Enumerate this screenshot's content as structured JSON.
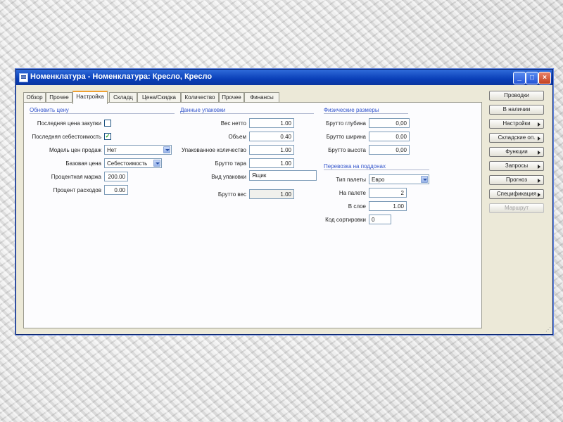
{
  "window": {
    "title": "Номенклатура - Номенклатура: Кресло, Кресло"
  },
  "tabs": [
    {
      "label": "Обзор"
    },
    {
      "label": "Прочее"
    },
    {
      "label": "Настройка"
    },
    {
      "label": "Складц"
    },
    {
      "label": "Цена/Скидка"
    },
    {
      "label": "Количество"
    },
    {
      "label": "Прочее"
    },
    {
      "label": "Финансы"
    }
  ],
  "cost_section": {
    "title": "Обновить цену",
    "last_purchase_price": {
      "label": "Последняя цена закупки",
      "checked": false
    },
    "last_cost": {
      "label": "Последняя себестоимость",
      "checked": true
    },
    "sales_model": {
      "label": "Модель цен продаж",
      "value": "Нет"
    },
    "base_price": {
      "label": "Базовая цена",
      "value": "Себестоимость"
    },
    "percent_markup": {
      "label": "Процентная маржа",
      "value": "200.00"
    },
    "percent_expense": {
      "label": "Процент расходов",
      "value": "0.00"
    }
  },
  "packing_section": {
    "title": "Данные упаковки",
    "net": {
      "label": "Вес нетто",
      "value": "1.00"
    },
    "volume": {
      "label": "Объем",
      "value": "0.40"
    },
    "packed_qty": {
      "label": "Упакованное количество",
      "value": "1.00"
    },
    "gross_tare": {
      "label": "Брутто тара",
      "value": "1.00"
    },
    "pack_group": {
      "label": "Вид упаковки",
      "value": "Ящик"
    },
    "gross": {
      "label": "Брутто вес",
      "value": "1.00"
    }
  },
  "physical_section": {
    "title": "Физические размеры",
    "depth": {
      "label": "Брутто глубина",
      "value": "0,00"
    },
    "width": {
      "label": "Брутто ширина",
      "value": "0,00"
    },
    "height": {
      "label": "Брутто высота",
      "value": "0,00"
    }
  },
  "cargo_section": {
    "title": "Перевозка на поддонах",
    "pallet_type": {
      "label": "Тип палеты",
      "value": "Евро"
    },
    "per_pallet": {
      "label": "На палете",
      "value": "2"
    },
    "layers": {
      "label": "В слое",
      "value": "1.00"
    },
    "sort_code": {
      "label": "Код сортировки",
      "value": "0"
    }
  },
  "side_buttons": [
    {
      "label": "Проводки",
      "arrow": false,
      "enabled": true
    },
    {
      "label": "В наличии",
      "arrow": false,
      "enabled": true
    },
    {
      "label": "Настройки",
      "arrow": true,
      "enabled": true
    },
    {
      "label": "Складские оп.",
      "arrow": true,
      "enabled": true
    },
    {
      "label": "Функции",
      "arrow": true,
      "enabled": true
    },
    {
      "label": "Запросы",
      "arrow": true,
      "enabled": true
    },
    {
      "label": "Прогноз",
      "arrow": true,
      "enabled": true
    },
    {
      "label": "Спецификация",
      "arrow": true,
      "enabled": true
    },
    {
      "label": "Маршрут",
      "arrow": false,
      "enabled": false
    }
  ],
  "icons": {
    "minimize": "minimize-icon",
    "maximize": "maximize-icon",
    "close": "close-icon",
    "app": "table-icon",
    "dropdown": "chevron-down-icon",
    "check": "checkmark-icon"
  },
  "colors": {
    "titlebar": "#0a3fb8",
    "tab_accent": "#f0a030",
    "section_title": "#3355cc"
  }
}
